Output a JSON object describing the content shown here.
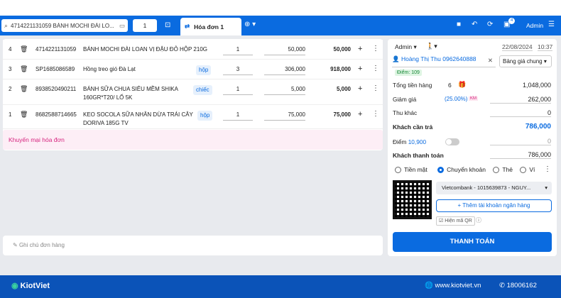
{
  "topbar": {
    "search_value": "4714221131059 BÁNH MOCHI ĐÀI LO...",
    "qty_value": "1",
    "tab_label": "Hóa đơn 1",
    "user": "Admin",
    "notif_count": "4"
  },
  "items": [
    {
      "index": "4",
      "code": "4714221131059",
      "name": "BÁNH MOCHI ĐÀI LOAN VỊ ĐẬU ĐỎ HỘP 210G",
      "name2": "",
      "unit": "",
      "qty": "1",
      "price": "50,000",
      "total": "50,000"
    },
    {
      "index": "3",
      "code": "SP1685086589",
      "name": "Hồng treo gió Đà Lạt",
      "name2": "",
      "unit": "hộp",
      "qty": "3",
      "price": "306,000",
      "total": "918,000"
    },
    {
      "index": "2",
      "code": "8938520490211",
      "name": "BÁNH SỮA CHUA SIÊU MỀM SHIKA",
      "name2": "160GR*T20/ LỐ 5K",
      "unit": "chiếc",
      "qty": "1",
      "price": "5,000",
      "total": "5,000"
    },
    {
      "index": "1",
      "code": "8682588714665",
      "name": "KEO SOCOLA SỮA NHÂN DỪA TRÁI CÂY",
      "name2": "DORIVA 185G TV",
      "unit": "hộp",
      "qty": "1",
      "price": "75,000",
      "total": "75,000"
    }
  ],
  "promo_label": "Khuyến mại hóa đơn",
  "note_placeholder": "Ghi chú đơn hàng",
  "right": {
    "seller": "Admin",
    "date": "22/08/2024",
    "time": "10:37",
    "customer": "Hoàng Thị Thu 0962640888",
    "points_badge": "Điểm: 109",
    "price_list": "Bảng giá chung",
    "total_label": "Tổng tiền hàng",
    "total_count": "6",
    "total_value": "1,048,000",
    "discount_label": "Giảm giá",
    "discount_pct": "(25.00%)",
    "discount_tag": "KM",
    "discount_value": "262,000",
    "other_label": "Thu khác",
    "other_value": "0",
    "due_label": "Khách cần trả",
    "due_value": "786,000",
    "point_label": "Điểm",
    "point_value": "10,900",
    "point_input": "0",
    "paid_label": "Khách thanh toán",
    "paid_value": "786,000",
    "methods": [
      "Tiền mặt",
      "Chuyển khoản",
      "Thẻ",
      "Ví"
    ],
    "bank": "Vietcombank - 1015639873 - NGUY...",
    "add_bank": "Thêm tài khoản ngân hàng",
    "show_qr": "Hiện mã QR",
    "pay_button": "THANH TOÁN"
  },
  "footer": {
    "brand": "KiotViet",
    "website": "www.kiotviet.vn",
    "hotline": "18006162"
  },
  "colors": {
    "primary": "#0a6be0",
    "footer": "#0b53b8",
    "promo": "#d6237e"
  }
}
